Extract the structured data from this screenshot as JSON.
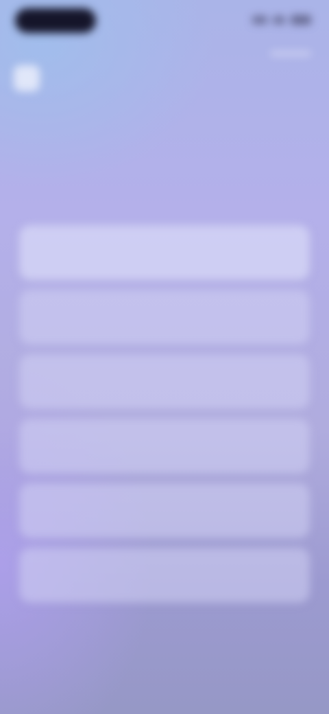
{
  "status_bar": {
    "icons": [
      "cellular-signal-icon",
      "wifi-icon",
      "battery-icon"
    ]
  },
  "header": {
    "app_name": "",
    "app_icon": "app-logo-icon"
  },
  "question": {
    "text": ""
  },
  "options": [
    {
      "label": ""
    },
    {
      "label": ""
    },
    {
      "label": ""
    },
    {
      "label": ""
    },
    {
      "label": ""
    },
    {
      "label": ""
    }
  ],
  "colors": {
    "background_top": "#aab4e8",
    "background_bottom": "#9698c6",
    "option_fill": "#d2d2f4"
  }
}
